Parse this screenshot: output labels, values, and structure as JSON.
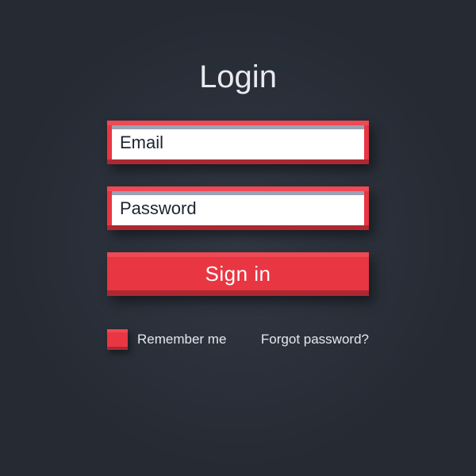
{
  "title": "Login",
  "email": {
    "placeholder": "Email",
    "value": ""
  },
  "password": {
    "placeholder": "Password",
    "value": ""
  },
  "signin_label": "Sign in",
  "remember_label": "Remember me",
  "forgot_label": "Forgot password?",
  "colors": {
    "accent": "#e83642",
    "bg": "#2b3039",
    "text_light": "#e8eaef"
  }
}
